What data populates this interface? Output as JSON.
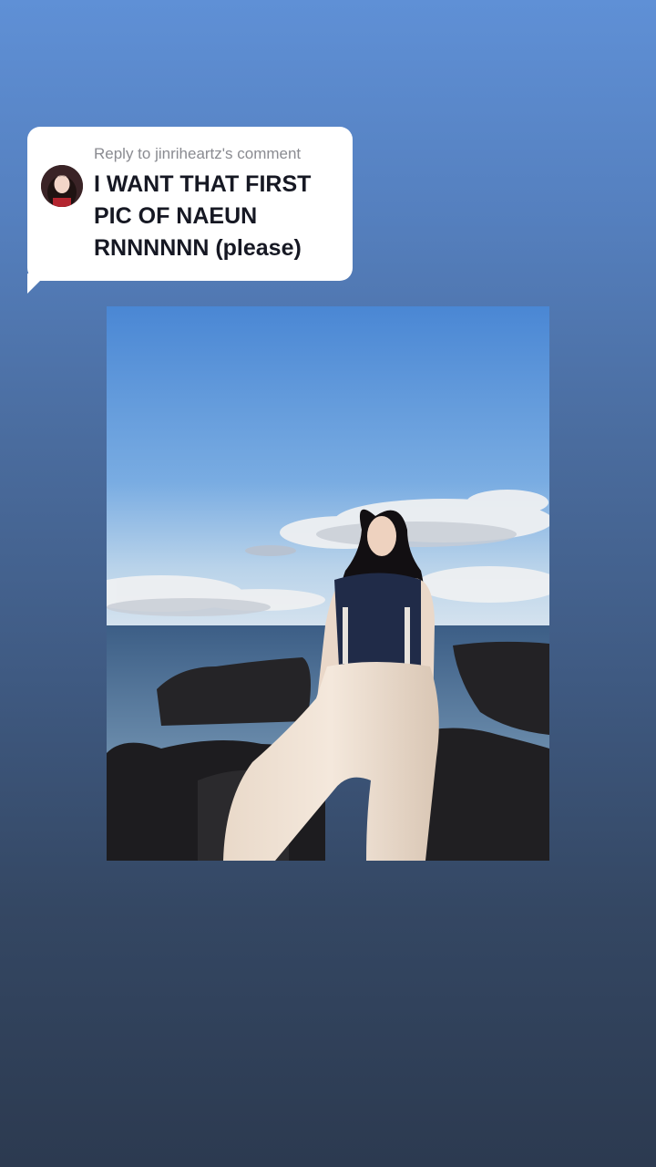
{
  "reply": {
    "header": "Reply to jinriheartz's comment",
    "comment": "I WANT THAT FIRST PIC OF NAEUN RNNNNNN (please)"
  },
  "colors": {
    "bubble": "#ffffff",
    "comment_text": "#161823",
    "header_text": "#8a8b91",
    "background_top": "#5f90d6",
    "background_bottom": "#2c3a50"
  },
  "icons": {
    "avatar": "user-avatar-icon"
  }
}
